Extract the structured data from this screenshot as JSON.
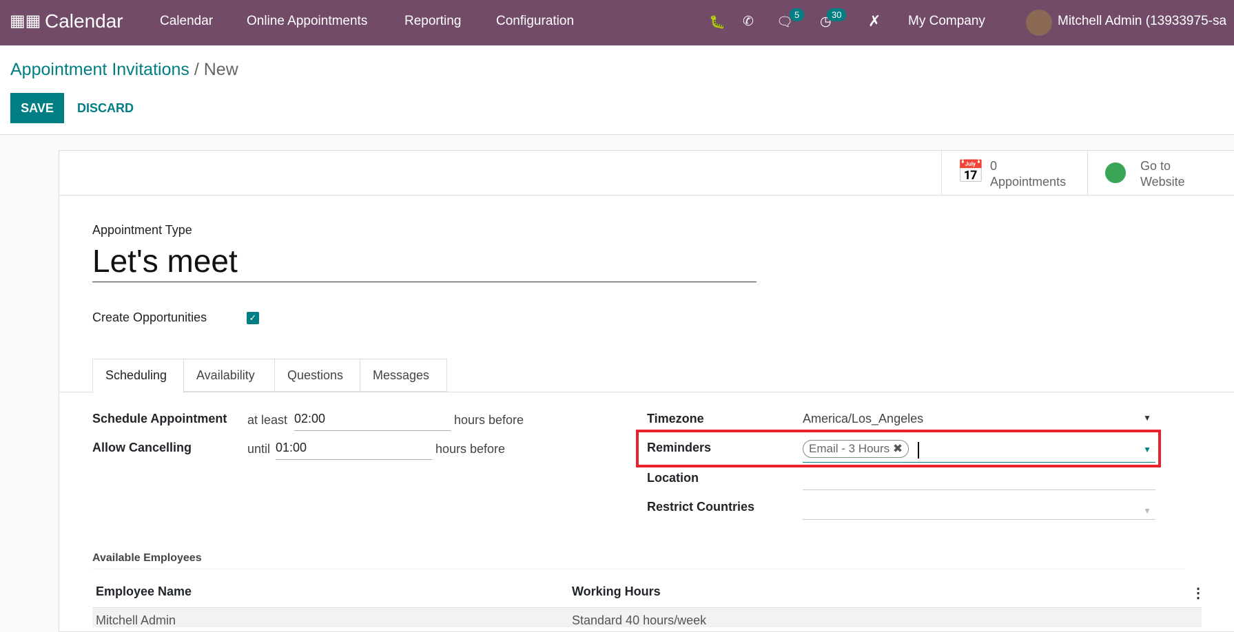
{
  "navbar": {
    "app_title": "Calendar",
    "menu": [
      "Calendar",
      "Online Appointments",
      "Reporting",
      "Configuration"
    ],
    "messages_count": "5",
    "activities_count": "30",
    "company": "My Company",
    "user": "Mitchell Admin (13933975-sa",
    "color": "#714b67"
  },
  "breadcrumb": {
    "parent": "Appointment Invitations",
    "separator": " / ",
    "current": "New"
  },
  "actions": {
    "save": "SAVE",
    "discard": "DISCARD"
  },
  "button_box": {
    "appointments_count": "0",
    "appointments_label": "Appointments",
    "website_line1": "Go to",
    "website_line2": "Website"
  },
  "form": {
    "type_label": "Appointment Type",
    "name": "Let's meet",
    "create_opportunities_label": "Create Opportunities",
    "create_opportunities": true,
    "tabs": [
      "Scheduling",
      "Availability",
      "Questions",
      "Messages"
    ],
    "active_tab": "Scheduling",
    "schedule_label": "Schedule Appointment",
    "schedule_prefix": "at least",
    "schedule_value": "02:00",
    "schedule_suffix": "hours before",
    "cancel_label": "Allow Cancelling",
    "cancel_prefix": "until",
    "cancel_value": "01:00",
    "cancel_suffix": "hours before",
    "timezone_label": "Timezone",
    "timezone_value": "America/Los_Angeles",
    "reminders_label": "Reminders",
    "reminder_tags": [
      "Email - 3 Hours"
    ],
    "location_label": "Location",
    "location_value": "",
    "countries_label": "Restrict Countries",
    "countries_value": "",
    "employees_section": "Available Employees",
    "employees_columns": [
      "Employee Name",
      "Working Hours"
    ],
    "employees_rows": [
      [
        "Mitchell Admin",
        "Standard 40 hours/week"
      ]
    ]
  },
  "accent": "#017e84",
  "highlight": "#e8212d"
}
